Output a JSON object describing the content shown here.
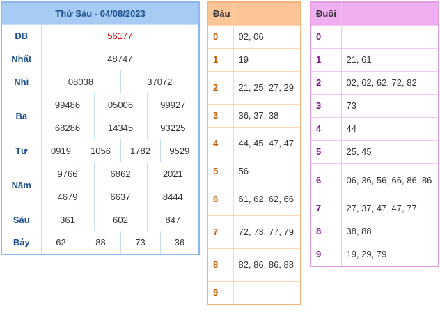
{
  "results": {
    "title": "Thứ Sáu - 04/08/2023",
    "db_label": "ĐB",
    "db": "56177",
    "nhat_label": "Nhất",
    "nhat": "48747",
    "nhi_label": "Nhì",
    "nhi": [
      "08038",
      "37072"
    ],
    "ba_label": "Ba",
    "ba": [
      "99486",
      "05006",
      "99927",
      "68286",
      "14345",
      "93225"
    ],
    "tu_label": "Tư",
    "tu": [
      "0919",
      "1056",
      "1782",
      "9529"
    ],
    "nam_label": "Năm",
    "nam": [
      "9766",
      "6862",
      "2021",
      "4679",
      "6637",
      "8444"
    ],
    "sau_label": "Sáu",
    "sau": [
      "361",
      "602",
      "847"
    ],
    "bay_label": "Bảy",
    "bay": [
      "62",
      "88",
      "73",
      "36"
    ]
  },
  "dau": {
    "header": "Đầu",
    "rows": [
      {
        "key": "0",
        "values": "02, 06"
      },
      {
        "key": "1",
        "values": "19"
      },
      {
        "key": "2",
        "values": "21, 25, 27, 29"
      },
      {
        "key": "3",
        "values": "36, 37, 38"
      },
      {
        "key": "4",
        "values": "44, 45, 47, 47"
      },
      {
        "key": "5",
        "values": "56"
      },
      {
        "key": "6",
        "values": "61, 62, 62, 66"
      },
      {
        "key": "7",
        "values": "72, 73, 77, 79"
      },
      {
        "key": "8",
        "values": "82, 86, 86, 88"
      },
      {
        "key": "9",
        "values": ""
      }
    ]
  },
  "duoi": {
    "header": "Đuôi",
    "rows": [
      {
        "key": "0",
        "values": ""
      },
      {
        "key": "1",
        "values": "21, 61"
      },
      {
        "key": "2",
        "values": "02, 62, 62, 72, 82"
      },
      {
        "key": "3",
        "values": "73"
      },
      {
        "key": "4",
        "values": "44"
      },
      {
        "key": "5",
        "values": "25, 45"
      },
      {
        "key": "6",
        "values": "06, 36, 56, 66, 86, 86"
      },
      {
        "key": "7",
        "values": "27, 37, 47, 47, 77"
      },
      {
        "key": "8",
        "values": "38, 88"
      },
      {
        "key": "9",
        "values": "19, 29, 79"
      }
    ]
  },
  "colors": {
    "results_header": "#a6ccf4",
    "special_prize": "#e50000",
    "dau_header": "#fbc597",
    "duoi_header": "#eeaef0"
  }
}
